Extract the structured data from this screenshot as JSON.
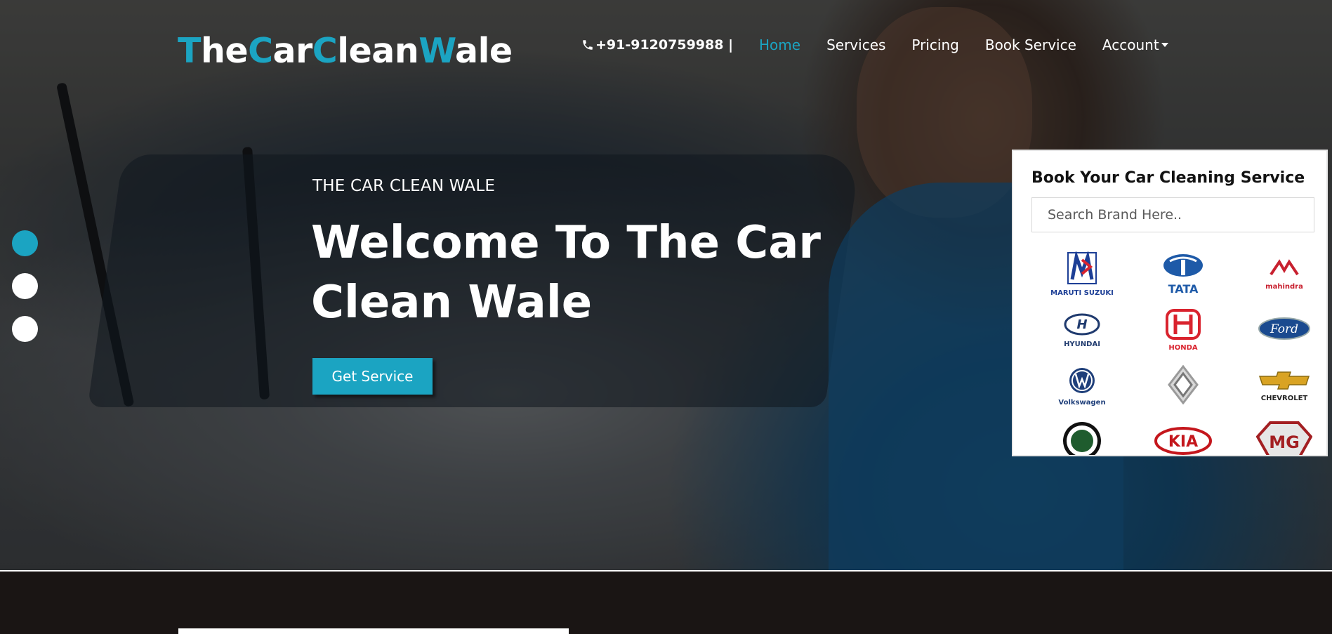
{
  "brand": {
    "logo_parts": [
      {
        "t": "T",
        "accent": true
      },
      {
        "t": "he",
        "accent": false
      },
      {
        "t": "C",
        "accent": true
      },
      {
        "t": "ar",
        "accent": false
      },
      {
        "t": "C",
        "accent": true
      },
      {
        "t": "lean",
        "accent": false
      },
      {
        "t": "W",
        "accent": true
      },
      {
        "t": "ale",
        "accent": false
      }
    ],
    "accent_color": "#1ba4c2"
  },
  "nav": {
    "phone": "+91-9120759988 |",
    "home": "Home",
    "services": "Services",
    "pricing": "Pricing",
    "book": "Book Service",
    "account": "Account"
  },
  "hero": {
    "eyebrow": "THE CAR CLEAN WALE",
    "headline": "Welcome To The Car Clean Wale",
    "cta": "Get Service",
    "active_slide": 1
  },
  "booking": {
    "title": "Book Your Car Cleaning Service",
    "search_placeholder": "Search Brand Here..",
    "brands": [
      {
        "name": "MARUTI SUZUKI",
        "icon": "maruti-suzuki-logo",
        "color": "#1d3f96"
      },
      {
        "name": "TATA",
        "icon": "tata-logo",
        "color": "#1e5aa8"
      },
      {
        "name": "mahindra",
        "icon": "mahindra-logo",
        "color": "#c8202f"
      },
      {
        "name": "HYUNDAI",
        "icon": "hyundai-logo",
        "color": "#1f3a6e"
      },
      {
        "name": "HONDA",
        "icon": "honda-logo",
        "color": "#d9232e"
      },
      {
        "name": "Ford",
        "icon": "ford-logo",
        "color": "#1a4a8f"
      },
      {
        "name": "Volkswagen",
        "icon": "volkswagen-logo",
        "color": "#1f3f7a"
      },
      {
        "name": "",
        "icon": "renault-logo",
        "color": "#9a9a9a"
      },
      {
        "name": "CHEVROLET",
        "icon": "chevrolet-logo",
        "color": "#d9a323"
      },
      {
        "name": "SKODA",
        "icon": "skoda-logo",
        "color": "#1f5c2e"
      },
      {
        "name": "KIA",
        "icon": "kia-logo",
        "color": "#c4161c"
      },
      {
        "name": "MG",
        "icon": "mg-logo",
        "color": "#a31f22"
      }
    ]
  }
}
